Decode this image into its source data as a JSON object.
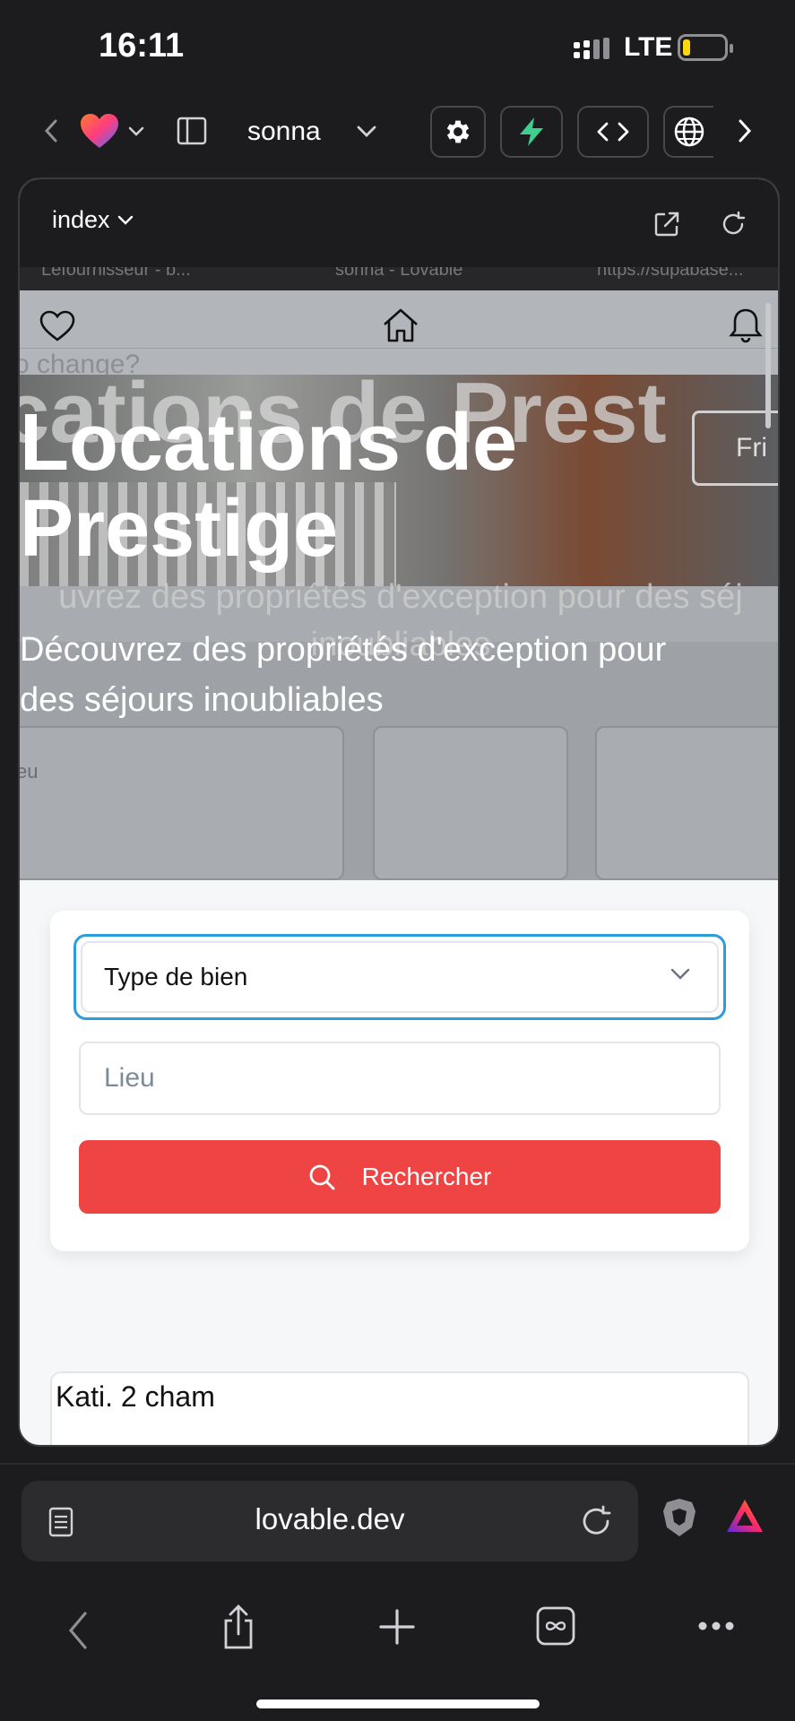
{
  "status_bar": {
    "time": "16:11",
    "network": "LTE"
  },
  "toolbar": {
    "project_name": "sonna"
  },
  "preview_header": {
    "page_selector": "index"
  },
  "ghost": {
    "tab1": "Lefournisseur - b...",
    "tab2": "sonna - Lovable",
    "tab3": "https://supabase...",
    "nav_hint": "o change?",
    "title": "cations de Prest",
    "sub_line1": "uvrez des propriétés d'exception pour des séj",
    "sub_line2": "inoubliables",
    "field_hint": "eu",
    "right_hint": "Fri"
  },
  "hero": {
    "title_line1": "Locations de",
    "title_line2": "Prestige",
    "subtitle_line1": "Découvrez des propriétés d'exception pour",
    "subtitle_line2": "des séjours inoubliables"
  },
  "search_form": {
    "type_select": "Type de bien",
    "location_placeholder": "Lieu",
    "search_button": "Rechercher",
    "accent_color": "#ef4444",
    "focus_color": "#2d9cdb"
  },
  "listing": {
    "title": "Kati. 2 cham"
  },
  "browser": {
    "url": "lovable.dev"
  }
}
